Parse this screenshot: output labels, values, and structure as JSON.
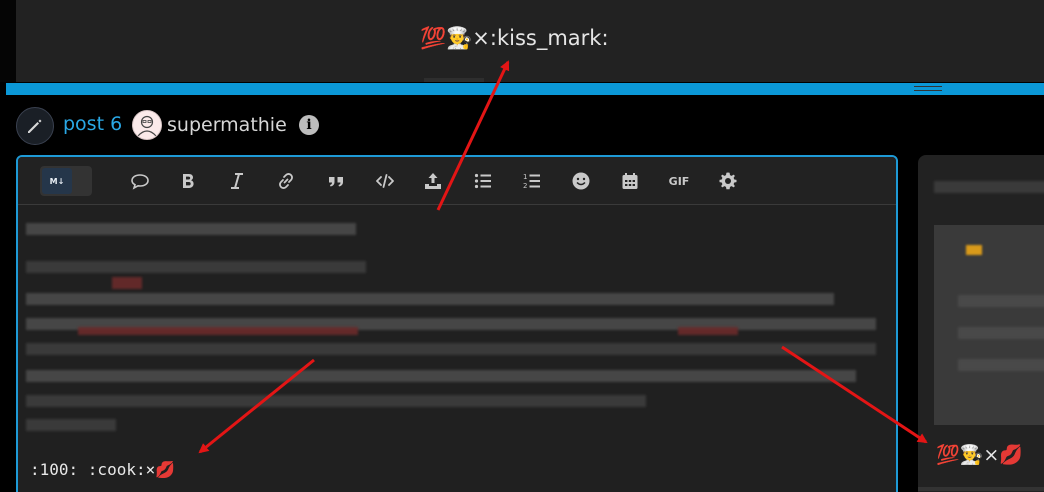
{
  "top": {
    "title": "💯👨‍🍳×:kiss_mark:"
  },
  "post": {
    "link_label": "post 6",
    "username": "supermathie",
    "info_glyph": "i"
  },
  "toolbar": {
    "markdown_toggle_label": "M↓",
    "gif_label": "GIF",
    "icons": [
      "markdown-toggle",
      "quote-bubble-icon",
      "bold-icon",
      "italic-icon",
      "link-icon",
      "blockquote-icon",
      "code-icon",
      "upload-icon",
      "bullet-list-icon",
      "numbered-list-icon",
      "emoji-icon",
      "calendar-icon",
      "gif-button",
      "gear-icon"
    ]
  },
  "editor": {
    "text": ":100: :cook:×💋"
  },
  "preview": {
    "text": "💯👨‍🍳×💋"
  },
  "colors": {
    "accent": "#0b98d7",
    "link": "#2aa8e6",
    "arrow": "#e31515",
    "editor_bg": "#202020"
  }
}
